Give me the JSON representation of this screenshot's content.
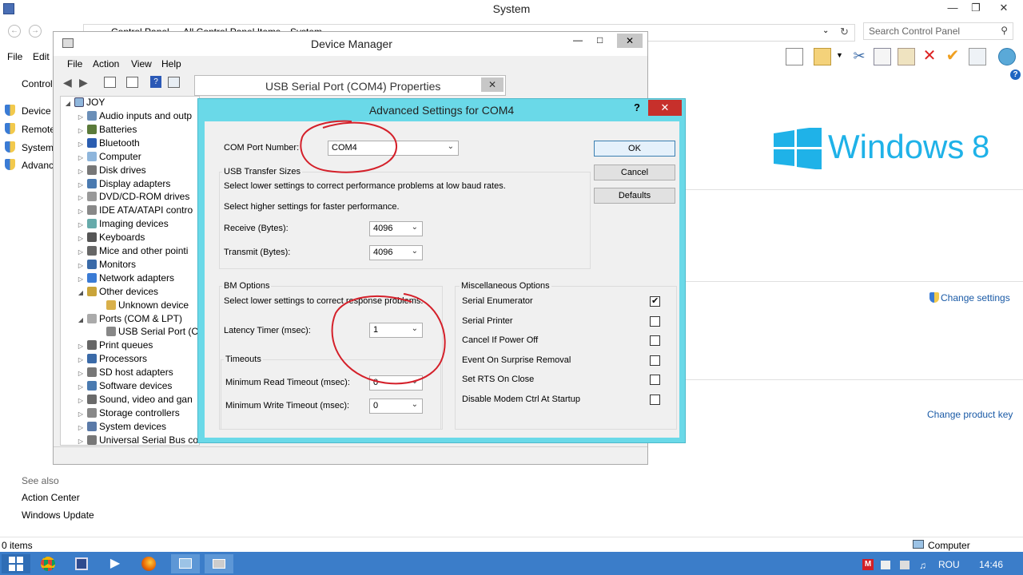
{
  "system_window": {
    "title": "System",
    "breadcrumbs": [
      "Control Panel",
      "All Control Panel Items",
      "System"
    ],
    "search_placeholder": "Search Control Panel",
    "menu": [
      "File",
      "Edit"
    ],
    "left_nav": [
      "Control",
      "Device M",
      "Remote",
      "System",
      "Advanc"
    ],
    "see_also_label": "See also",
    "see_also_links": [
      "Action Center",
      "Windows Update"
    ],
    "change_settings": "Change settings",
    "change_product_key": "Change product key",
    "windows_logo_text": "Windows",
    "windows_logo_version": "8",
    "status_items": "0 items",
    "status_computer": "Computer"
  },
  "device_manager": {
    "title": "Device Manager",
    "menu": [
      "File",
      "Action",
      "View",
      "Help"
    ],
    "tree_root": "JOY",
    "tree": [
      {
        "label": "Audio inputs and outp",
        "expanded": false,
        "indent": 1
      },
      {
        "label": "Batteries",
        "expanded": false,
        "indent": 1
      },
      {
        "label": "Bluetooth",
        "expanded": false,
        "indent": 1
      },
      {
        "label": "Computer",
        "expanded": false,
        "indent": 1
      },
      {
        "label": "Disk drives",
        "expanded": false,
        "indent": 1
      },
      {
        "label": "Display adapters",
        "expanded": false,
        "indent": 1
      },
      {
        "label": "DVD/CD-ROM drives",
        "expanded": false,
        "indent": 1
      },
      {
        "label": "IDE ATA/ATAPI contro",
        "expanded": false,
        "indent": 1
      },
      {
        "label": "Imaging devices",
        "expanded": false,
        "indent": 1
      },
      {
        "label": "Keyboards",
        "expanded": false,
        "indent": 1
      },
      {
        "label": "Mice and other pointi",
        "expanded": false,
        "indent": 1
      },
      {
        "label": "Monitors",
        "expanded": false,
        "indent": 1
      },
      {
        "label": "Network adapters",
        "expanded": false,
        "indent": 1
      },
      {
        "label": "Other devices",
        "expanded": true,
        "indent": 1
      },
      {
        "label": "Unknown device",
        "expanded": null,
        "indent": 2
      },
      {
        "label": "Ports (COM & LPT)",
        "expanded": true,
        "indent": 1
      },
      {
        "label": "USB Serial Port (CC",
        "expanded": null,
        "indent": 2
      },
      {
        "label": "Print queues",
        "expanded": false,
        "indent": 1
      },
      {
        "label": "Processors",
        "expanded": false,
        "indent": 1
      },
      {
        "label": "SD host adapters",
        "expanded": false,
        "indent": 1
      },
      {
        "label": "Software devices",
        "expanded": false,
        "indent": 1
      },
      {
        "label": "Sound, video and gan",
        "expanded": false,
        "indent": 1
      },
      {
        "label": "Storage controllers",
        "expanded": false,
        "indent": 1
      },
      {
        "label": "System devices",
        "expanded": false,
        "indent": 1
      },
      {
        "label": "Universal Serial Bus con",
        "expanded": false,
        "indent": 1
      }
    ]
  },
  "properties_dialog": {
    "title": "USB Serial Port (COM4) Properties"
  },
  "advanced": {
    "title": "Advanced Settings for COM4",
    "help": "?",
    "com_port_label": "COM Port Number:",
    "com_port_value": "COM4",
    "usb_group": "USB Transfer Sizes",
    "usb_hint1": "Select lower settings to correct performance problems at low baud rates.",
    "usb_hint2": "Select higher settings for faster performance.",
    "receive_label": "Receive (Bytes):",
    "receive_value": "4096",
    "transmit_label": "Transmit (Bytes):",
    "transmit_value": "4096",
    "bm_group": "BM Options",
    "bm_hint": "Select lower settings to correct response problems.",
    "latency_label": "Latency Timer (msec):",
    "latency_value": "1",
    "timeouts_group": "Timeouts",
    "read_timeout_label": "Minimum Read Timeout (msec):",
    "read_timeout_value": "0",
    "write_timeout_label": "Minimum Write Timeout (msec):",
    "write_timeout_value": "0",
    "misc_group": "Miscellaneous Options",
    "options": [
      {
        "label": "Serial Enumerator",
        "checked": true
      },
      {
        "label": "Serial Printer",
        "checked": false
      },
      {
        "label": "Cancel If Power Off",
        "checked": false
      },
      {
        "label": "Event On Surprise Removal",
        "checked": false
      },
      {
        "label": "Set RTS On Close",
        "checked": false
      },
      {
        "label": "Disable Modem Ctrl At Startup",
        "checked": false
      }
    ],
    "ok_label": "OK",
    "cancel_label": "Cancel",
    "defaults_label": "Defaults"
  },
  "taskbar": {
    "lang": "ROU",
    "time": "14:46"
  },
  "colors": {
    "dialog_frame": "#6ad9e8",
    "taskbar": "#3b7dc9",
    "link": "#1a5aa6",
    "annotation": "#d4202a",
    "win8_logo": "#1fb2e8"
  }
}
